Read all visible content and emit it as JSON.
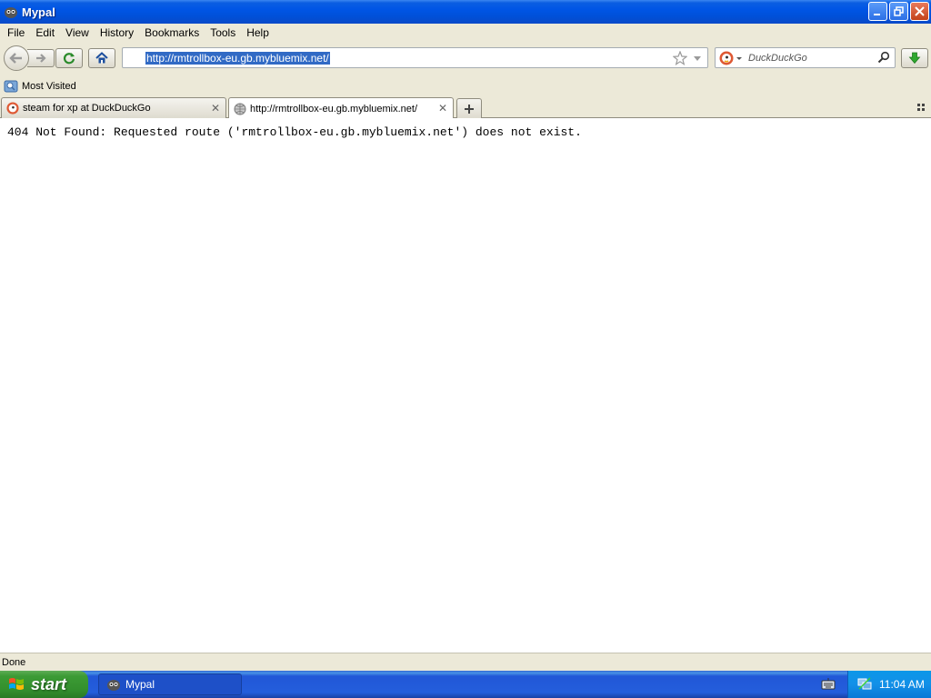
{
  "window": {
    "title": "Mypal"
  },
  "menu": {
    "items": [
      {
        "label": "File"
      },
      {
        "label": "Edit"
      },
      {
        "label": "View"
      },
      {
        "label": "History"
      },
      {
        "label": "Bookmarks"
      },
      {
        "label": "Tools"
      },
      {
        "label": "Help"
      }
    ]
  },
  "nav": {
    "url": "http://rmtrollbox-eu.gb.mybluemix.net/",
    "search_placeholder": "DuckDuckGo"
  },
  "bookmarks": {
    "most_visited": "Most Visited"
  },
  "tabs": [
    {
      "title": "steam for xp at DuckDuckGo",
      "active": false
    },
    {
      "title": "http://rmtrollbox-eu.gb.mybluemix.net/",
      "active": true
    }
  ],
  "content": {
    "message": "404 Not Found: Requested route ('rmtrollbox-eu.gb.mybluemix.net') does not exist."
  },
  "status": {
    "text": "Done"
  },
  "taskbar": {
    "start_label": "start",
    "task_item": "Mypal",
    "clock": "11:04 AM"
  },
  "colors": {
    "titlebar": "#0055e5",
    "taskbar": "#245edc",
    "start_button": "#3c9b35",
    "url_selection": "#316ac5"
  }
}
